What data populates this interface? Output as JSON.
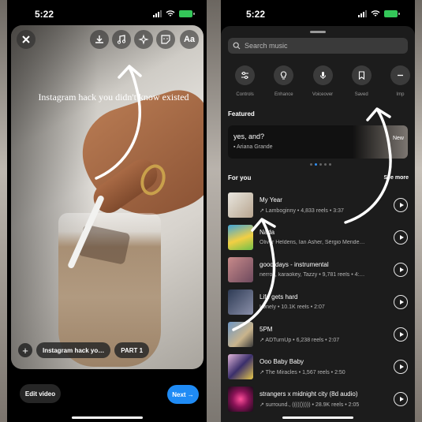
{
  "left": {
    "status_time": "5:22",
    "overlay_text": "Instagram hack you didn't know existed",
    "toolbar": {
      "text_tool": "Aa"
    },
    "chips": [
      "Instagram hack yo…",
      "PART 1"
    ],
    "edit_label": "Edit video",
    "next_label": "Next →"
  },
  "right": {
    "status_time": "5:22",
    "search_placeholder": "Search music",
    "tools": [
      "Controls",
      "Enhance",
      "Voiceover",
      "Saved",
      "Imp"
    ],
    "featured_title": "Featured",
    "featured": {
      "song": "yes, and?",
      "artist": "Ariana Grande",
      "badge": "New"
    },
    "for_you_title": "For you",
    "see_more": "See more",
    "tracks": [
      {
        "title": "My Year",
        "sub": "↗ Lamboginny • 4,833 reels • 3:37"
      },
      {
        "title": "Nada",
        "sub": "Oliver Heldens, Ian Asher, Sérgio Mende…"
      },
      {
        "title": "good days - instrumental",
        "sub": "nerrox, karaokey, Tazzy • 9,781 reels • 4:…"
      },
      {
        "title": "Life gets hard",
        "sub": "Lønely • 10.1K reels • 2:07"
      },
      {
        "title": "5PM",
        "sub": "↗ ADTurnUp • 6,238 reels • 2:07"
      },
      {
        "title": "Ooo Baby Baby",
        "sub": "↗ The Miracles • 1,567 reels • 2:50"
      },
      {
        "title": "strangers x midnight city (8d audio)",
        "sub": "↗ surround., ((((())))) • 28.9K reels • 2:05"
      }
    ]
  },
  "colors": {
    "accent": "#1f8bf5",
    "sheet": "#1c1c1c",
    "battery": "#34c759"
  }
}
